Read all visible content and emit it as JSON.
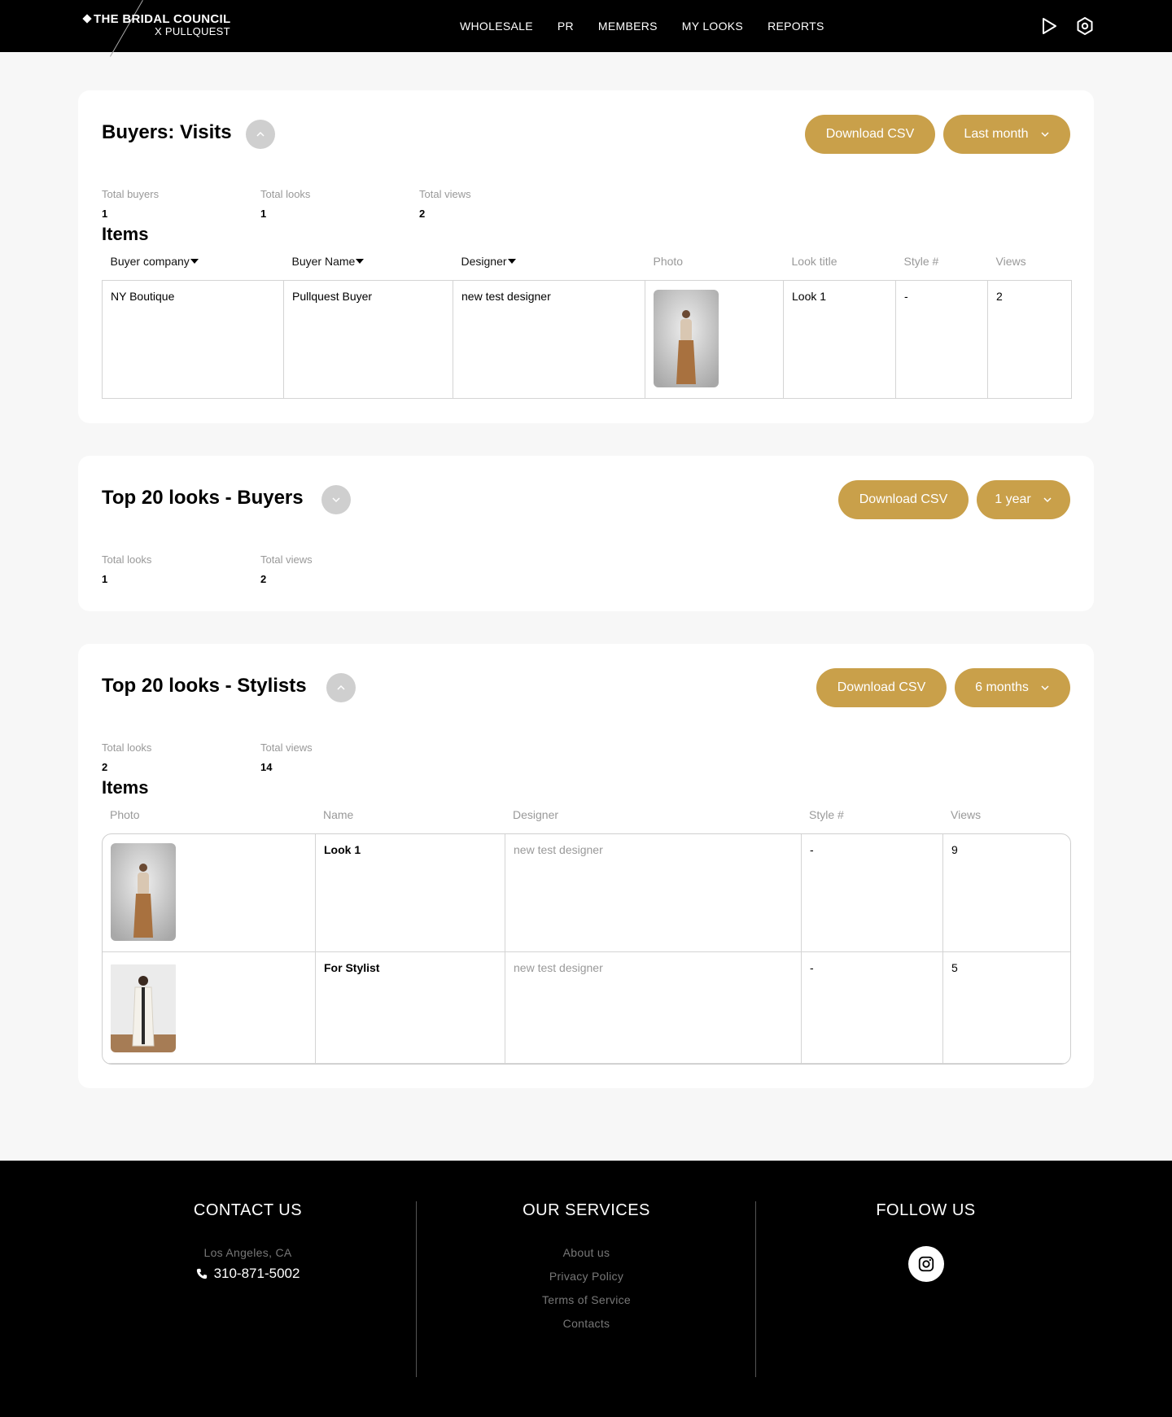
{
  "brand": {
    "line1": "THE BRIDAL COUNCIL",
    "line2": "X PULLQUEST"
  },
  "nav": [
    "WHOLESALE",
    "PR",
    "MEMBERS",
    "MY LOOKS",
    "REPORTS"
  ],
  "colors": {
    "accent": "#c9a04a",
    "nav_bg": "#000000",
    "toggle": "#cfcfcf"
  },
  "visits": {
    "title": "Buyers: Visits",
    "download": "Download CSV",
    "period": "Last month",
    "stats": [
      {
        "label": "Total buyers",
        "value": "1"
      },
      {
        "label": "Total looks",
        "value": "1"
      },
      {
        "label": "Total views",
        "value": "2"
      }
    ],
    "items_heading": "Items",
    "columns": [
      "Buyer company",
      "Buyer Name",
      "Designer",
      "Photo",
      "Look title",
      "Style #",
      "Views"
    ],
    "rows": [
      {
        "company": "NY Boutique",
        "buyer": "Pullquest Buyer",
        "designer": "new test designer",
        "look": "Look 1",
        "style": "-",
        "views": "2"
      }
    ]
  },
  "top_buyers": {
    "title": "Top 20 looks - Buyers",
    "download": "Download CSV",
    "period": "1 year",
    "stats": [
      {
        "label": "Total looks",
        "value": "1"
      },
      {
        "label": "Total views",
        "value": "2"
      }
    ]
  },
  "top_stylists": {
    "title": "Top 20 looks - Stylists",
    "download": "Download CSV",
    "period": "6 months",
    "stats": [
      {
        "label": "Total looks",
        "value": "2"
      },
      {
        "label": "Total views",
        "value": "14"
      }
    ],
    "items_heading": "Items",
    "columns": [
      "Photo",
      "Name",
      "Designer",
      "Style #",
      "Views"
    ],
    "rows": [
      {
        "name": "Look 1",
        "designer": "new test designer",
        "style": "-",
        "views": "9"
      },
      {
        "name": "For Stylist",
        "designer": "new test designer",
        "style": "-",
        "views": "5"
      }
    ]
  },
  "footer": {
    "contact_title": "CONTACT US",
    "location": "Los Angeles, CA",
    "phone": "310-871-5002",
    "services_title": "OUR SERVICES",
    "services": [
      "About us",
      "Privacy Policy",
      "Terms of Service",
      "Contacts"
    ],
    "follow_title": "FOLLOW US"
  }
}
